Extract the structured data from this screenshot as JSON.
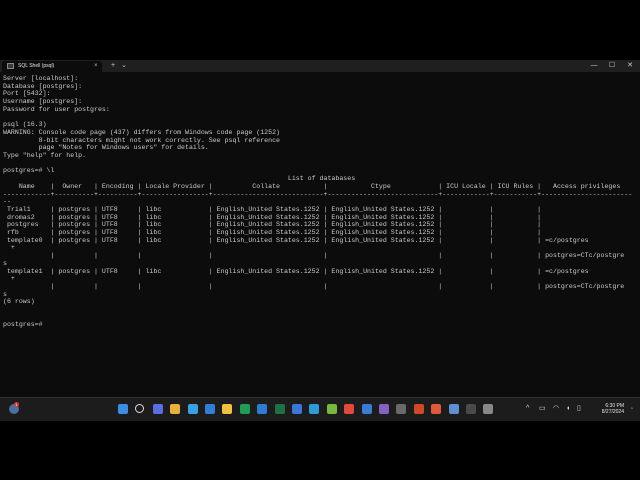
{
  "window": {
    "tab_title": "SQL Shell (psql)",
    "tab_close": "×",
    "new_tab": "+",
    "dropdown": "⌄",
    "minimize": "—",
    "maximize": "☐",
    "close": "✕"
  },
  "terminal": {
    "lines": [
      "Server [localhost]:",
      "Database [postgres]:",
      "Port [5432]:",
      "Username [postgres]:",
      "Password for user postgres:",
      "",
      "psql (16.3)",
      "WARNING: Console code page (437) differs from Windows code page (1252)",
      "         8-bit characters might not work correctly. See psql reference",
      "         page \"Notes for Windows users\" for details.",
      "Type \"help\" for help.",
      "",
      "postgres=# \\l",
      "                                                                        List of databases",
      "    Name    |  Owner   | Encoding | Locale Provider |          Collate           |           Ctype            | ICU Locale | ICU Rules |   Access privileges",
      "------------+----------+----------+-----------------+----------------------------+----------------------------+------------+-----------+-----------------------",
      "--",
      " Trial1     | postgres | UTF8     | libc            | English_United States.1252 | English_United States.1252 |            |           |",
      " dromas2    | postgres | UTF8     | libc            | English_United States.1252 | English_United States.1252 |            |           |",
      " postgres   | postgres | UTF8     | libc            | English_United States.1252 | English_United States.1252 |            |           |",
      " rfb        | postgres | UTF8     | libc            | English_United States.1252 | English_United States.1252 |            |           |",
      " template0  | postgres | UTF8     | libc            | English_United States.1252 | English_United States.1252 |            |           | =c/postgres",
      "  +",
      "            |          |          |                 |                            |                            |            |           | postgres=CTc/postgre",
      "s",
      " template1  | postgres | UTF8     | libc            | English_United States.1252 | English_United States.1252 |            |           | =c/postgres",
      "  +",
      "            |          |          |                 |                            |                            |            |           | postgres=CTc/postgre",
      "s",
      "(6 rows)",
      "",
      "",
      "postgres=#"
    ]
  },
  "taskbar": {
    "weather_badge": "1",
    "time": "6:30 PM",
    "date": "8/27/2024",
    "icon_colors": [
      "#3a8ee6",
      "#dddddd",
      "#5b6ee1",
      "#e8b23a",
      "#3aa0e6",
      "#2f7fd6",
      "#f0c040",
      "#1f9d55",
      "#2b7cd3",
      "#1e7145",
      "#3a78d8",
      "#2d9bd8",
      "#78b83a",
      "#e04a3a",
      "#3a7bd5",
      "#8661c5",
      "#6a6a6a",
      "#d24726",
      "#e05a3a",
      "#5f8fd0",
      "#4a4a4a",
      "#888888"
    ]
  },
  "colors": {
    "terminal_bg": "#0c0c0c",
    "terminal_fg": "#cccccc",
    "taskbar_bg": "#1c1c1c"
  }
}
